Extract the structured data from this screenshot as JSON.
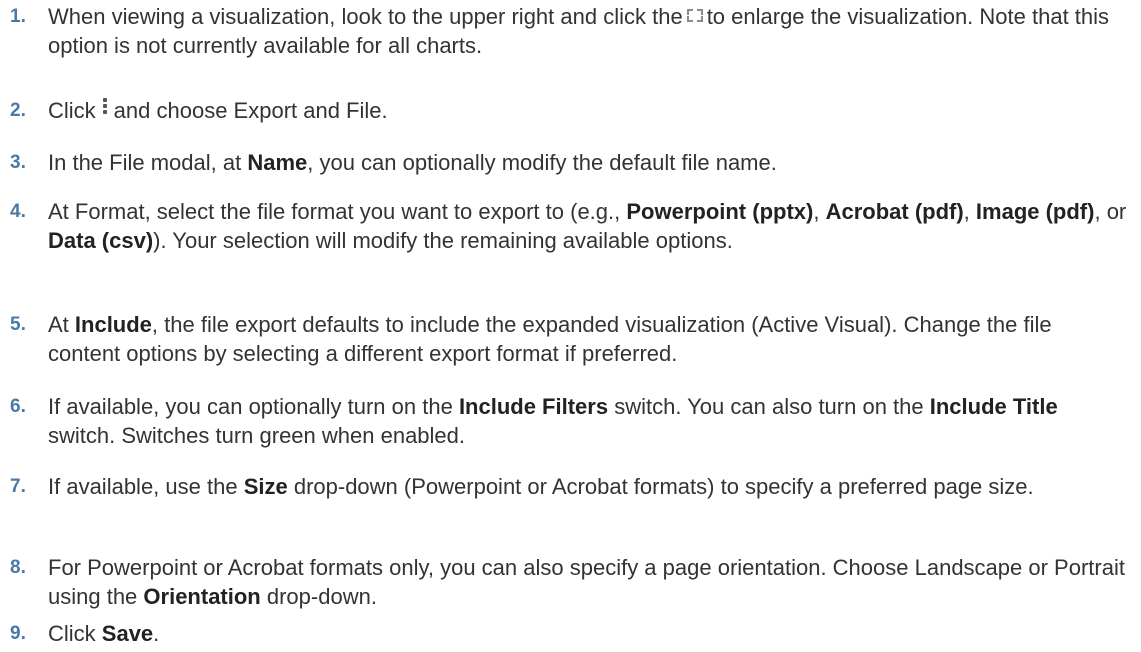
{
  "steps": [
    {
      "number": "1.",
      "text_before_icon": "When viewing a visualization, look to the upper right and click the",
      "icon": "expand-icon",
      "text_after_icon": "to enlarge the visualization. Note that this option is not currently available for all charts."
    },
    {
      "number": "2.",
      "text_before_icon": "Click",
      "icon": "kebab-menu-icon",
      "text_after_icon": "and choose Export and File."
    },
    {
      "number": "3.",
      "text_a": "In the File modal, at ",
      "bold_a": "Name",
      "text_b": ", you can optionally modify the default file name."
    },
    {
      "number": "4.",
      "text_a": "At Format, select the file format you want to export to (e.g., ",
      "bold_a": "Powerpoint (pptx)",
      "text_b": ", ",
      "bold_b": "Acrobat (pdf)",
      "text_c": ", ",
      "bold_c": "Image (pdf)",
      "text_d": ", or ",
      "bold_d": "Data (csv)",
      "text_e": "). Your selection will modify the remaining available options."
    },
    {
      "number": "5.",
      "text_a": "At ",
      "bold_a": "Include",
      "text_b": ", the file export defaults to include the expanded visualization (Active Visual). Change the file content options by selecting a different export format if preferred."
    },
    {
      "number": "6.",
      "text_a": "If available, you can optionally turn on the ",
      "bold_a": "Include Filters",
      "text_b": " switch. You can also turn on the ",
      "bold_b": "Include Title",
      "text_c": " switch. Switches turn green when enabled."
    },
    {
      "number": "7.",
      "text_a": "If available, use the ",
      "bold_a": "Size",
      "text_b": " drop-down (Powerpoint or Acrobat formats) to specify a preferred page size."
    },
    {
      "number": "8.",
      "text_a": "For Powerpoint or Acrobat formats only, you can also specify a page orientation. Choose Landscape or Portrait using the ",
      "bold_a": "Orientation",
      "text_b": " drop-down."
    },
    {
      "number": "9.",
      "text_a": "Click ",
      "bold_a": "Save",
      "text_b": "."
    }
  ],
  "colors": {
    "step_number": "#4a79a8",
    "body_text": "#333333"
  }
}
